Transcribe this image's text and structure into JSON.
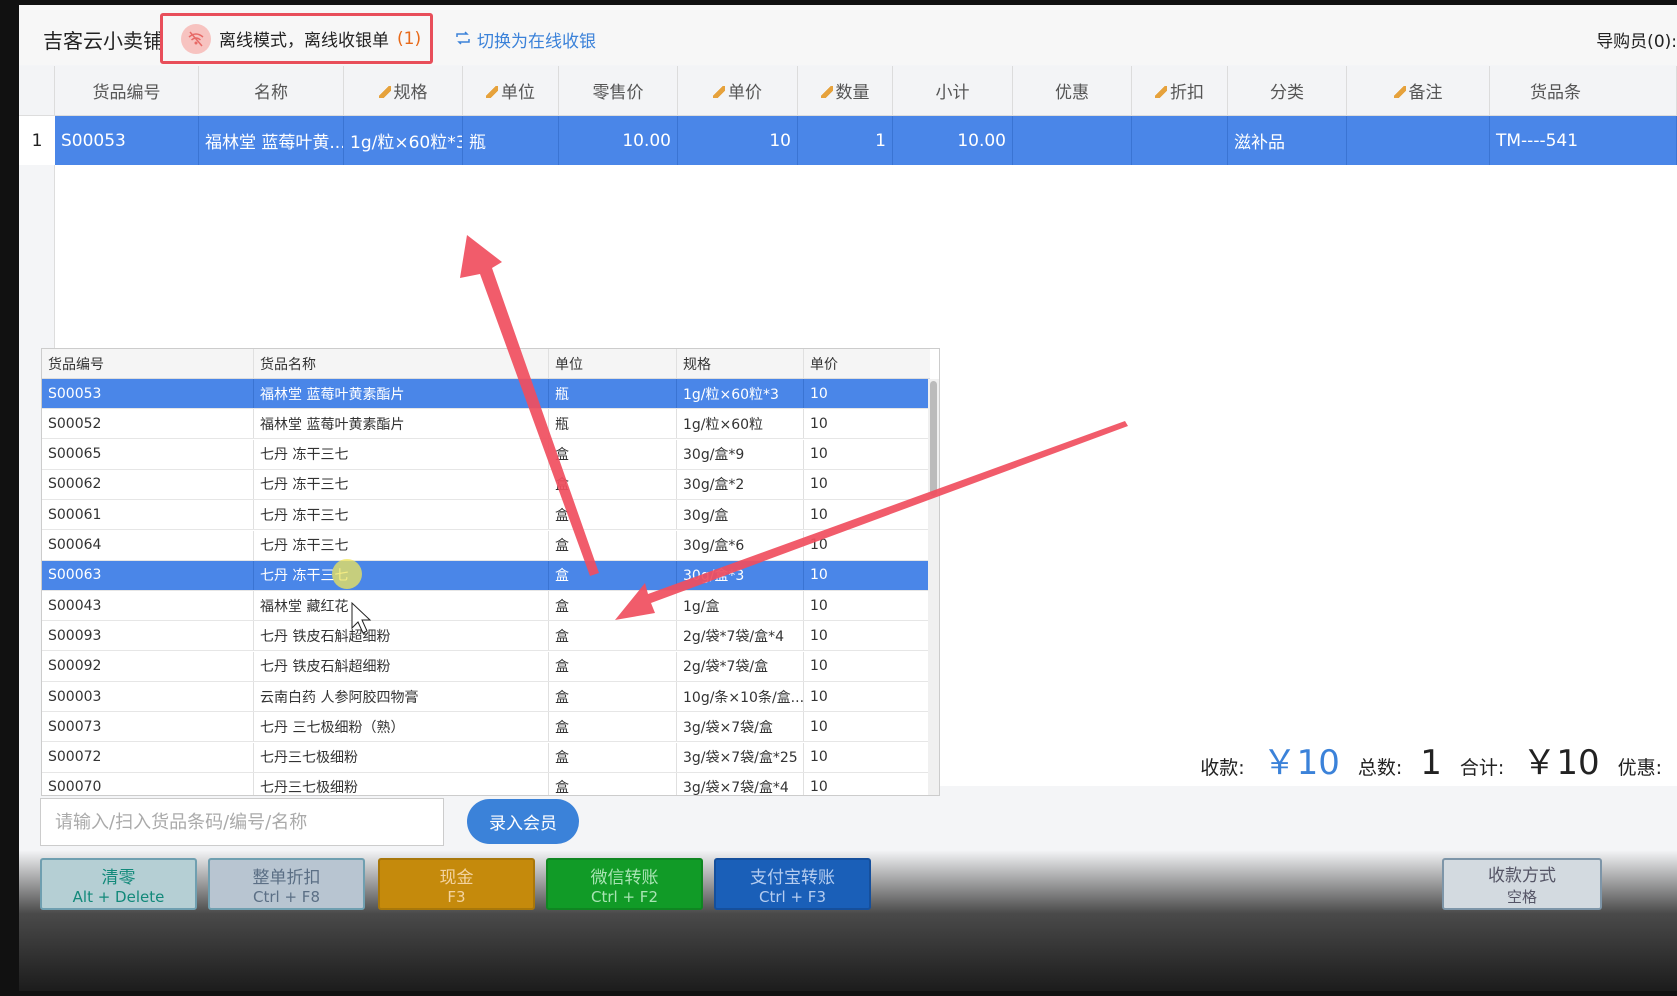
{
  "header": {
    "shop_name": "吉客云小卖铺",
    "offline_text": "离线模式，离线收银单",
    "offline_count": "(1)",
    "switch_online": "切换为在线收银",
    "guide_label": "导购员(0):"
  },
  "main_table": {
    "columns": [
      "货品编号",
      "名称",
      "规格",
      "单位",
      "零售价",
      "单价",
      "数量",
      "小计",
      "优惠",
      "折扣",
      "分类",
      "备注",
      "货品条"
    ],
    "rows": [
      {
        "index": "1",
        "code": "S00053",
        "name": "福林堂 蓝莓叶黄...",
        "spec": "1g/粒×60粒*3",
        "unit": "瓶",
        "retail": "10.00",
        "price": "10",
        "qty": "1",
        "subtotal": "10.00",
        "discount": "",
        "rebate": "",
        "category": "滋补品",
        "remark": "",
        "barcode": "TM----541"
      }
    ]
  },
  "dropdown": {
    "columns": [
      "货品编号",
      "货品名称",
      "单位",
      "规格",
      "单价"
    ],
    "rows": [
      {
        "code": "S00053",
        "name": "福林堂 蓝莓叶黄素酯片",
        "unit": "瓶",
        "spec": "1g/粒×60粒*3",
        "price": "10"
      },
      {
        "code": "S00052",
        "name": "福林堂 蓝莓叶黄素酯片",
        "unit": "瓶",
        "spec": "1g/粒×60粒",
        "price": "10"
      },
      {
        "code": "S00065",
        "name": "七丹 冻干三七",
        "unit": "盒",
        "spec": "30g/盒*9",
        "price": "10"
      },
      {
        "code": "S00062",
        "name": "七丹 冻干三七",
        "unit": "盒",
        "spec": "30g/盒*2",
        "price": "10"
      },
      {
        "code": "S00061",
        "name": "七丹 冻干三七",
        "unit": "盒",
        "spec": "30g/盒",
        "price": "10"
      },
      {
        "code": "S00064",
        "name": "七丹 冻干三七",
        "unit": "盒",
        "spec": "30g/盒*6",
        "price": "10"
      },
      {
        "code": "S00063",
        "name": "七丹 冻干三七",
        "unit": "盒",
        "spec": "30g/盒*3",
        "price": "10"
      },
      {
        "code": "S00043",
        "name": "福林堂 藏红花",
        "unit": "盒",
        "spec": "1g/盒",
        "price": "10"
      },
      {
        "code": "S00093",
        "name": "七丹 铁皮石斛超细粉",
        "unit": "盒",
        "spec": "2g/袋*7袋/盒*4",
        "price": "10"
      },
      {
        "code": "S00092",
        "name": "七丹 铁皮石斛超细粉",
        "unit": "盒",
        "spec": "2g/袋*7袋/盒",
        "price": "10"
      },
      {
        "code": "S00003",
        "name": "云南白药 人参阿胶四物膏",
        "unit": "盒",
        "spec": "10g/条×10条/盒...",
        "price": "10"
      },
      {
        "code": "S00073",
        "name": "七丹 三七极细粉（熟）",
        "unit": "盒",
        "spec": "3g/袋×7袋/盒",
        "price": "10"
      },
      {
        "code": "S00072",
        "name": "七丹三七极细粉",
        "unit": "盒",
        "spec": "3g/袋×7袋/盒*25",
        "price": "10"
      },
      {
        "code": "S00070",
        "name": "七丹三七极细粉",
        "unit": "盒",
        "spec": "3g/袋×7袋/盒*4",
        "price": "10"
      }
    ]
  },
  "totals": {
    "pay_label": "收款:",
    "pay_value": "￥10",
    "count_label": "总数:",
    "count_value": "1",
    "sum_label": "合计:",
    "sum_value": "￥10",
    "discount_label": "优惠:"
  },
  "search": {
    "placeholder": "请输入/扫入货品条码/编号/名称"
  },
  "member_button": "录入会员",
  "buttons": {
    "clear": {
      "label": "清零",
      "shortcut": "Alt + Delete"
    },
    "discount": {
      "label": "整单折扣",
      "shortcut": "Ctrl + F8"
    },
    "cash": {
      "label": "现金",
      "shortcut": "F3"
    },
    "wechat": {
      "label": "微信转账",
      "shortcut": "Ctrl + F2"
    },
    "alipay": {
      "label": "支付宝转账",
      "shortcut": "Ctrl + F3"
    },
    "paymethod": {
      "label": "收款方式",
      "shortcut": "空格"
    }
  },
  "colors": {
    "accent": "#3b82d9",
    "selection": "#4a86e8",
    "annotation": "#f04e5e"
  }
}
